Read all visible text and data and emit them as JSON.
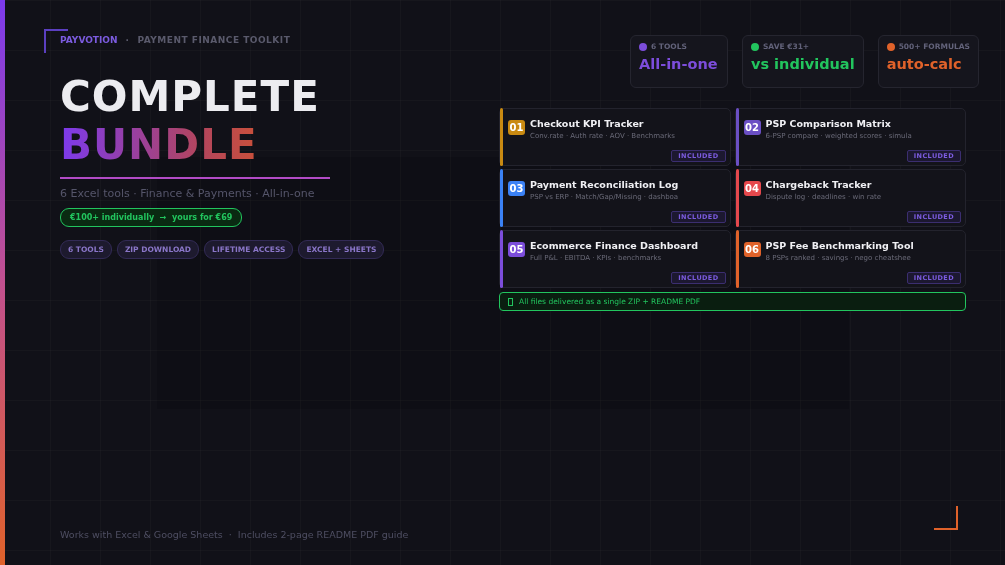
{
  "brand": {
    "name": "PAYVOTION",
    "separator": "·",
    "tagline": "PAYMENT FINANCE TOOLKIT"
  },
  "title": {
    "line_1": "COMPLETE",
    "line_2": "BUNDLE"
  },
  "subtitle": "6 Excel tools · Finance & Payments · All-in-one",
  "price_note": "€100+ individually  →  yours for €69",
  "tags": [
    "6 TOOLS",
    "ZIP DOWNLOAD",
    "LIFETIME ACCESS",
    "EXCEL + SHEETS"
  ],
  "stats": [
    {
      "label": "6 TOOLS",
      "value": "All-in-one",
      "color": "#7c4ddb"
    },
    {
      "label": "SAVE €31+",
      "value": "vs individual",
      "color": "#22c55e"
    },
    {
      "label": "500+ FORMULAS",
      "value": "auto-calc",
      "color": "#e0622a"
    }
  ],
  "tools": [
    {
      "number": "01",
      "name": "Checkout KPI Tracker",
      "description": "Conv.rate · Auth rate · AOV · Benchmarks",
      "badge": "INCLUDED",
      "color": "#c98a12"
    },
    {
      "number": "02",
      "name": "PSP Comparison Matrix",
      "description": "6-PSP compare · weighted scores · simula",
      "badge": "INCLUDED",
      "color": "#6a4fc4"
    },
    {
      "number": "03",
      "name": "Payment Reconciliation Log",
      "description": "PSP vs ERP · Match/Gap/Missing · dashboa",
      "badge": "INCLUDED",
      "color": "#3b82f6"
    },
    {
      "number": "04",
      "name": "Chargeback Tracker",
      "description": "Dispute log · deadlines · win rate",
      "badge": "INCLUDED",
      "color": "#e5484d"
    },
    {
      "number": "05",
      "name": "Ecommerce Finance Dashboard",
      "description": "Full P&L · EBITDA · KPIs · benchmarks",
      "badge": "INCLUDED",
      "color": "#7c4ddb"
    },
    {
      "number": "06",
      "name": "PSP Fee Benchmarking Tool",
      "description": "8 PSPs ranked · savings · nego cheatshee",
      "badge": "INCLUDED",
      "color": "#e0622a"
    }
  ],
  "delivery_note": "All files delivered as a single ZIP + README PDF",
  "footer": "Works with Excel & Google Sheets  ·  Includes 2-page README PDF guide"
}
